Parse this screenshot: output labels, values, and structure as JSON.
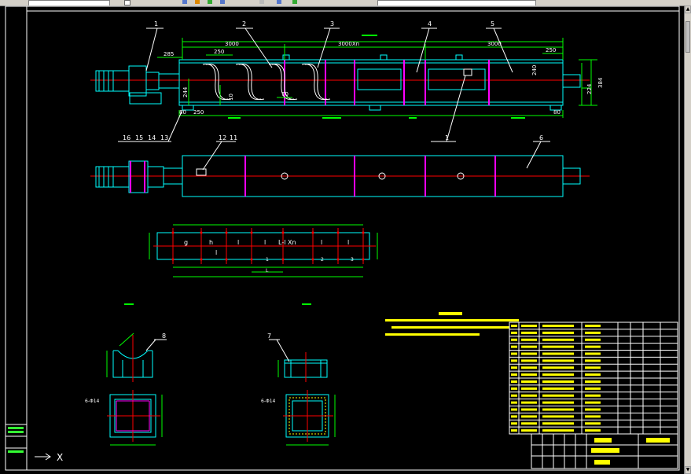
{
  "app": {
    "colors": {
      "background": "#000000",
      "frame": "#ffffff",
      "outline": "#00ffff",
      "dimension": "#00ff00",
      "centerline": "#ff0000",
      "flange": "#ff00ff",
      "leader": "#ffffff",
      "text": "#ffffff",
      "title_accent": "#ffff00"
    }
  },
  "drawing": {
    "balloons": {
      "b1": "1",
      "b2": "2",
      "b3": "3",
      "b4": "4",
      "b5": "5",
      "b6": "6",
      "b7": "7",
      "b8": "8",
      "b16": "16",
      "b15": "15",
      "b14": "14",
      "b13": "13",
      "b12": "12",
      "b11": "11",
      "bA": "1"
    },
    "dims": {
      "d3000a": "3000",
      "d3000b": "3000Xn",
      "d3000c": "3000",
      "d285": "285",
      "d250a": "250",
      "d250b": "250",
      "d70": "70",
      "d10": "10",
      "d80a": "80",
      "d250c": "250",
      "d80b": "80",
      "d244": "244",
      "d224": "224",
      "d384": "384",
      "d240": "240"
    },
    "layout_labels": {
      "g": "g",
      "h": "h",
      "l1": "l",
      "l2": "l",
      "lxn": "L-l Xn",
      "l3": "l",
      "l4": "l",
      "l5": "l",
      "one": "1",
      "two": "2",
      "three": "3",
      "L": "L"
    },
    "detail": {
      "sixholes_a": "6-Φ14",
      "sixholes_b": "6-Φ14"
    }
  },
  "ucs": {
    "x_label": "X"
  }
}
